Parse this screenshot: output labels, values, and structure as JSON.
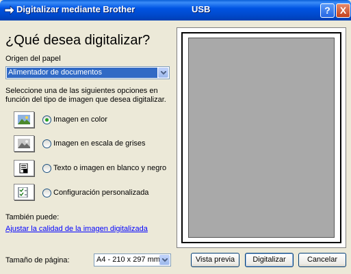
{
  "window": {
    "title": "Digitalizar mediante Brother",
    "connection": "USB"
  },
  "title_buttons": {
    "help": "?",
    "close": "X"
  },
  "heading": "¿Qué desea digitalizar?",
  "paper_source": {
    "label": "Origen del papel",
    "value": "Alimentador de documentos"
  },
  "instructions": "Seleccione una de las siguientes opciones en función del tipo de imagen que desea digitalizar.",
  "options": [
    {
      "label": "Imagen en color",
      "selected": true,
      "icon": "color-photo-icon"
    },
    {
      "label": "Imagen en escala de grises",
      "selected": false,
      "icon": "grayscale-photo-icon"
    },
    {
      "label": "Texto o imagen en blanco y negro",
      "selected": false,
      "icon": "bw-text-icon"
    },
    {
      "label": "Configuración personalizada",
      "selected": false,
      "icon": "custom-settings-icon"
    }
  ],
  "also": {
    "label": "También puede:",
    "link": "Ajustar la calidad de la imagen digitalizada"
  },
  "page_size": {
    "label": "Tamaño de página:",
    "value": "A4 - 210 x 297 mm"
  },
  "buttons": {
    "preview": "Vista previa",
    "scan": "Digitalizar",
    "cancel": "Cancelar"
  },
  "colors": {
    "titlebar": "#0054e3",
    "selection": "#316ac5",
    "link": "#0000ff",
    "preview_page": "#a9a9a9"
  }
}
